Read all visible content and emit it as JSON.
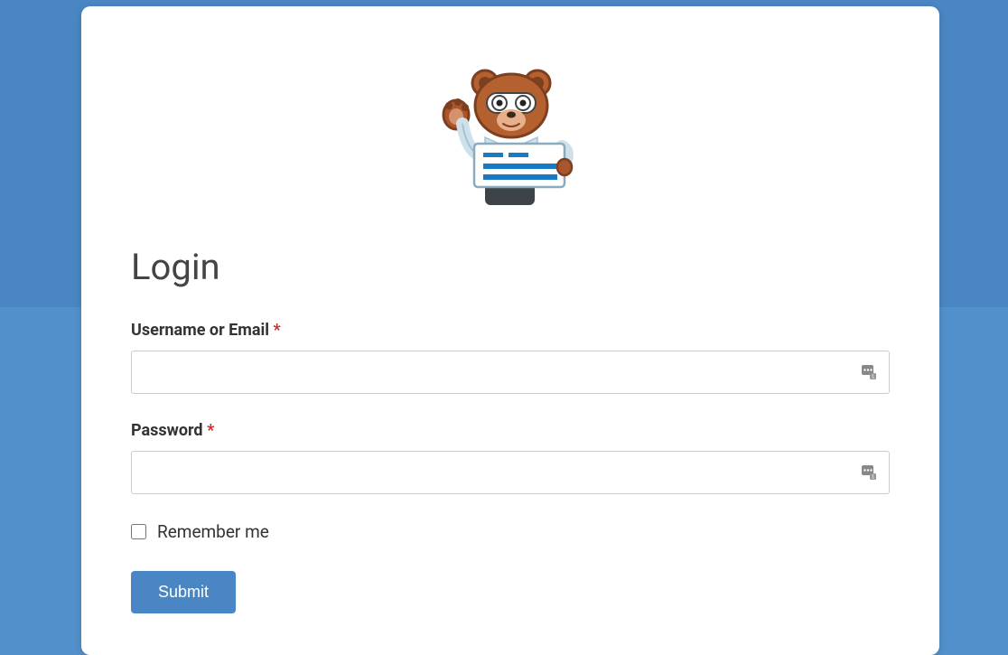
{
  "form": {
    "title": "Login",
    "username": {
      "label": "Username or Email",
      "required_marker": "*",
      "value": ""
    },
    "password": {
      "label": "Password",
      "required_marker": "*",
      "value": ""
    },
    "remember": {
      "label": "Remember me",
      "checked": false
    },
    "submit_label": "Submit"
  },
  "colors": {
    "accent": "#4a86c3",
    "bg": "#5290cb",
    "required": "#c9302c"
  }
}
